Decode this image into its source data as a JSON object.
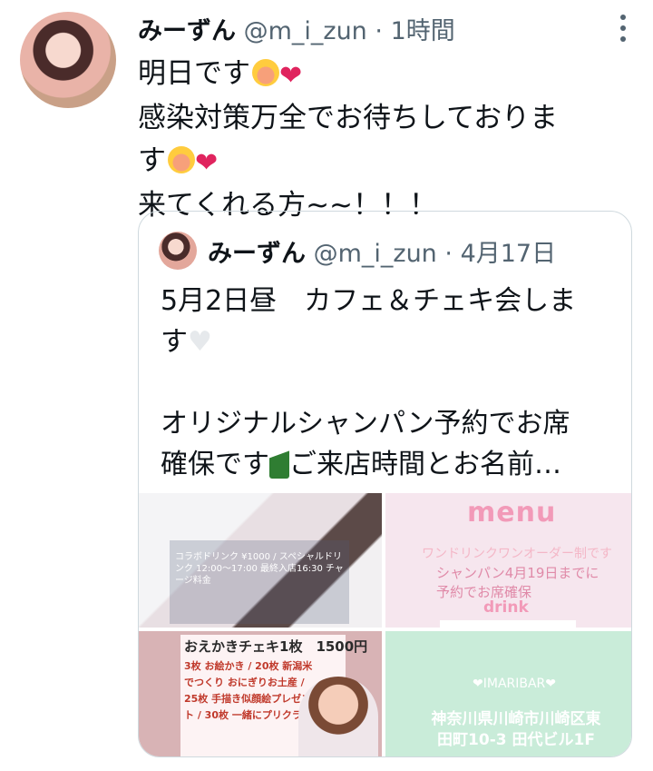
{
  "tweet": {
    "display_name": "みーずん",
    "handle": "@m_i_zun",
    "separator": "·",
    "time": "1時間",
    "line1": "明日です",
    "line2": "感染対策万全でお待ちしておりま",
    "line3": "す",
    "line4": "来てくれる方~~！！！"
  },
  "quoted": {
    "display_name": "みーずん",
    "handle": "@m_i_zun",
    "separator": "·",
    "date": "4月17日",
    "line1": "5月2日昼　カフェ＆チェキ会しま",
    "line2": "す",
    "line3": "オリジナルシャンパン予約でお席",
    "line4": "確保です",
    "line5": "ご来店時間とお名前…"
  },
  "images": {
    "img1_text": "コラボドリンク ¥1000 / スペシャルドリンク 12:00〜17:00 最終入店16:30 チャージ料金",
    "img2_title": "menu",
    "img2_sub": "ワンドリンクワンオーダー制です",
    "img2_body": "シャンパン4月19日までに予約でお席確保",
    "img2_drink": "drink",
    "img3_title": "おえかきチェキ1枚　1500円",
    "img3_lines": "3枚 お絵かき / 20枚 新潟米でつくり おにぎりお土産 / 25枚 手描き似顔絵プレゼント / 30枚 一緒にプリクラ",
    "img4_bar": "❤IMARIBAR❤",
    "img4_addr": "神奈川県川崎市川崎区東田町10-3 田代ビル1F"
  },
  "icons": {
    "more": "more-vertical-icon",
    "smile": "smiling-face-icon",
    "heart": "red-heart-icon"
  },
  "colors": {
    "name": "#0f1419",
    "meta": "#536471",
    "border": "#cfd9de",
    "heart": "#e0245e"
  }
}
